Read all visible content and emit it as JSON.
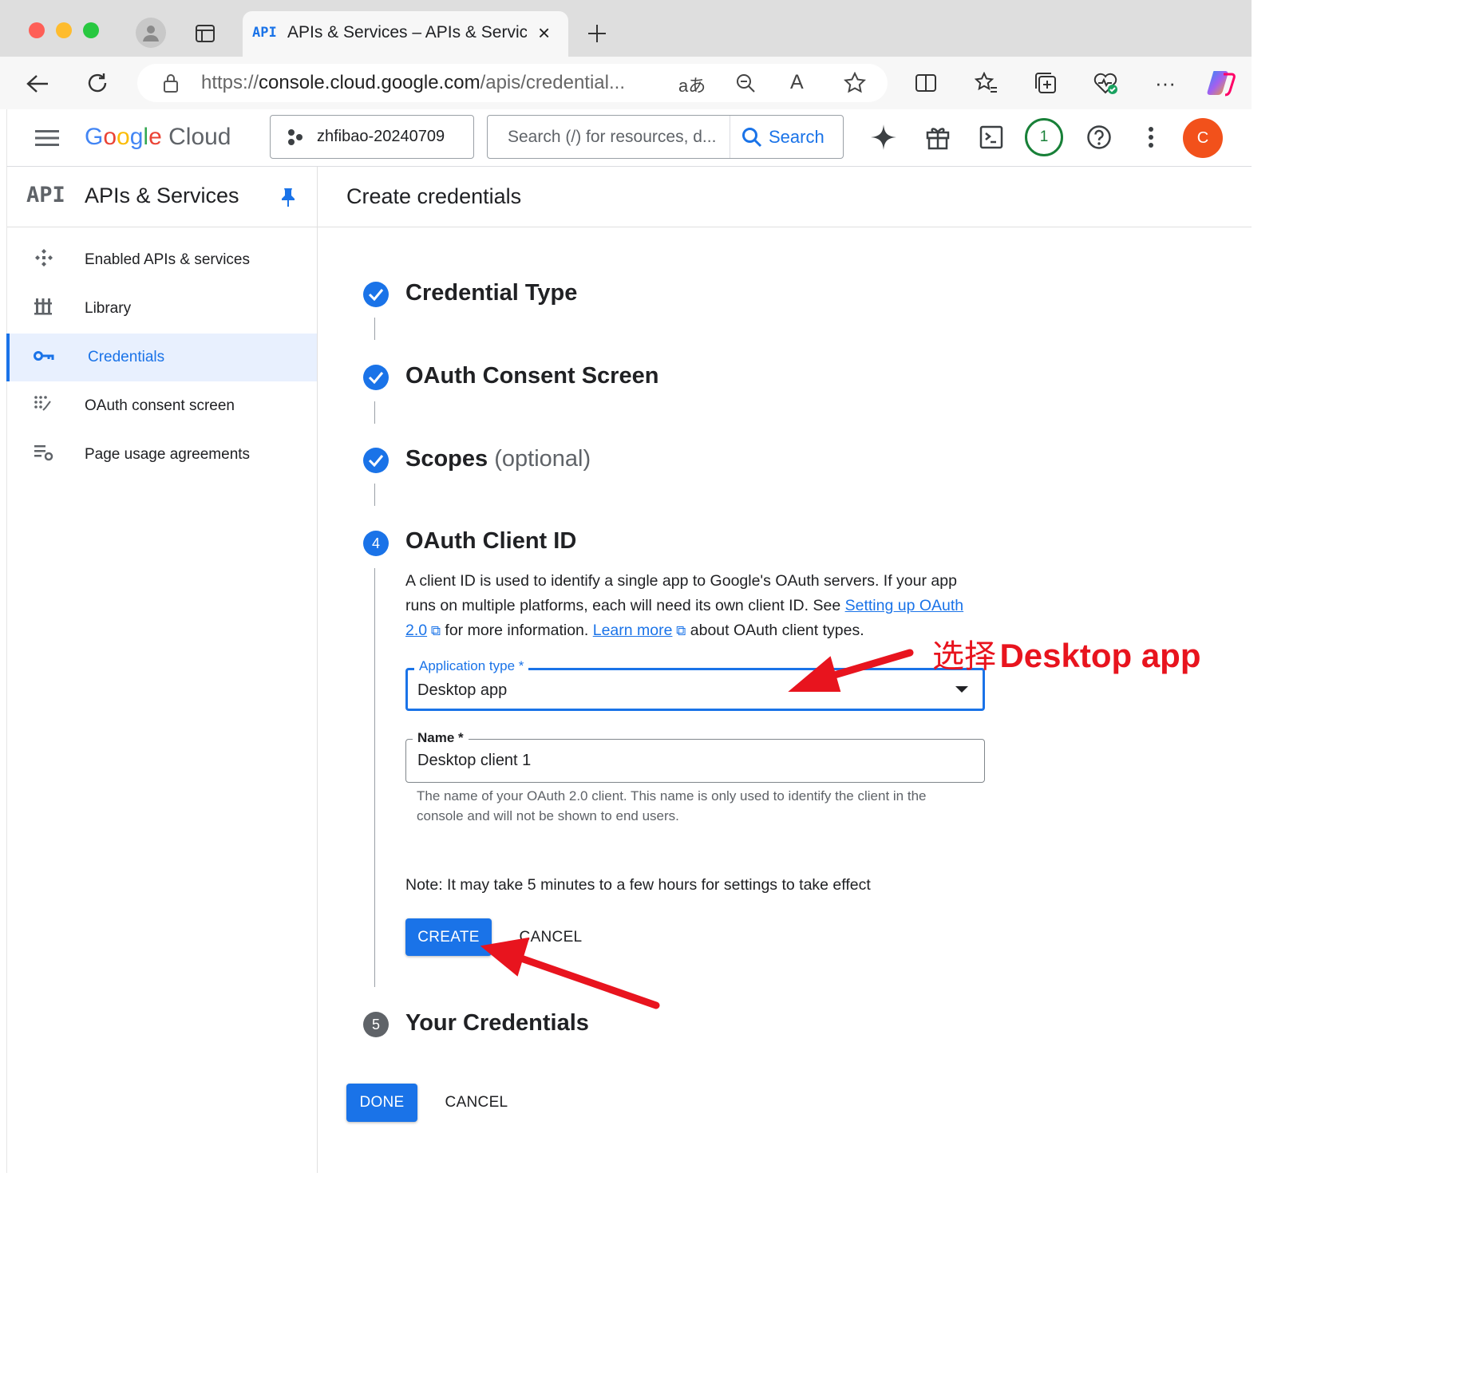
{
  "browser": {
    "tab_badge": "API",
    "tab_title": "APIs & Services – APIs & Servic",
    "url_prefix": "https://",
    "url_host": "console.cloud.google.com",
    "url_path": "/apis/credential...",
    "translate_glyph": "aあ",
    "read_aloud_glyph": "A"
  },
  "header": {
    "logo_google": "Google",
    "logo_cloud": "Cloud",
    "project": "zhfibao-20240709",
    "search_placeholder": "Search (/) for resources, d...",
    "search_label": "Search",
    "notification_count": "1",
    "avatar_initial": "C"
  },
  "sidebar": {
    "badge": "API",
    "title": "APIs & Services",
    "items": [
      {
        "label": "Enabled APIs & services"
      },
      {
        "label": "Library"
      },
      {
        "label": "Credentials"
      },
      {
        "label": "OAuth consent screen"
      },
      {
        "label": "Page usage agreements"
      }
    ]
  },
  "main": {
    "page_title": "Create credentials",
    "steps": [
      {
        "title": "Credential Type"
      },
      {
        "title": "OAuth Consent Screen"
      },
      {
        "title": "Scopes",
        "suffix": "(optional)"
      },
      {
        "number": "4",
        "title": "OAuth Client ID"
      },
      {
        "number": "5",
        "title": "Your Credentials"
      }
    ],
    "description_1": "A client ID is used to identify a single app to Google's OAuth servers. If your app runs on multiple platforms, each will need its own client ID. See",
    "link_setup": "Setting up OAuth 2.0",
    "description_2": "for more information.",
    "link_learn": "Learn more",
    "description_3": "about OAuth client types.",
    "app_type_label": "Application type *",
    "app_type_value": "Desktop app",
    "name_label": "Name *",
    "name_value": "Desktop client 1",
    "name_help": "The name of your OAuth 2.0 client. This name is only used to identify the client in the console and will not be shown to end users.",
    "note": "Note: It may take 5 minutes to a few hours for settings to take effect",
    "create_label": "CREATE",
    "cancel_label": "CANCEL",
    "done_label": "DONE",
    "cancel2_label": "CANCEL"
  },
  "annotation": {
    "text_cn": "选择",
    "text_en": "Desktop app",
    "color": "#e8141e"
  }
}
